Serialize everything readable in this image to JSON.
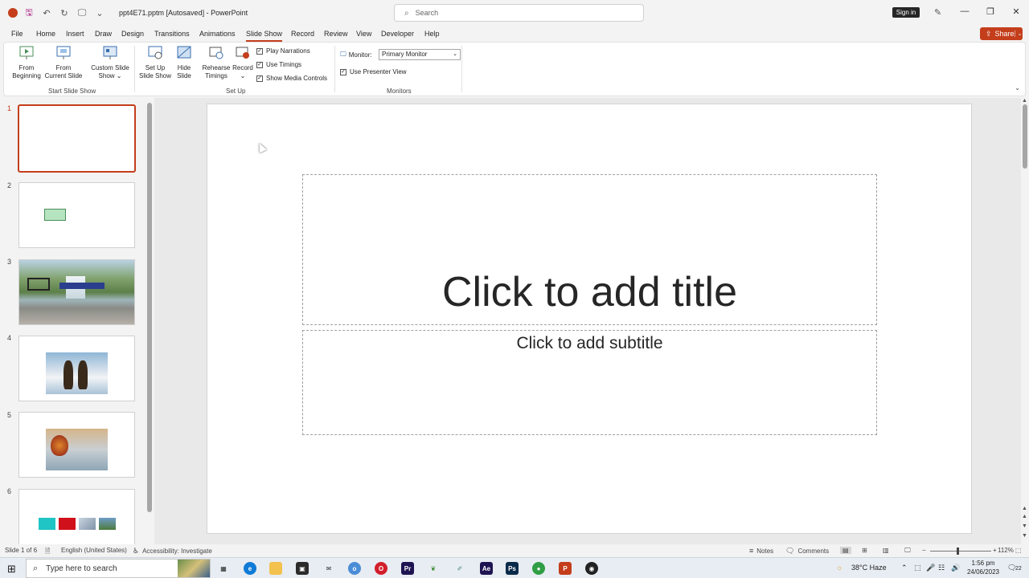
{
  "titlebar": {
    "doc_title": "ppt4E71.pptm [Autosaved]  -  PowerPoint",
    "search_placeholder": "Search",
    "signin_label": "Sign in"
  },
  "ribbon_tabs": [
    "File",
    "Home",
    "Insert",
    "Draw",
    "Design",
    "Transitions",
    "Animations",
    "Slide Show",
    "Record",
    "Review",
    "View",
    "Developer",
    "Help"
  ],
  "active_tab": "Slide Show",
  "share_label": "Share",
  "ribbon": {
    "start_group": {
      "label": "Start Slide Show",
      "from_beginning": [
        "From",
        "Beginning"
      ],
      "from_current": [
        "From",
        "Current Slide"
      ],
      "custom": [
        "Custom Slide",
        "Show ⌄"
      ]
    },
    "setup_group": {
      "label": "Set Up",
      "setup_show": [
        "Set Up",
        "Slide Show"
      ],
      "hide_slide": [
        "Hide",
        "Slide"
      ],
      "rehearse": [
        "Rehearse",
        "Timings"
      ],
      "record": [
        "Record",
        "⌄"
      ],
      "play_narrations": "Play Narrations",
      "use_timings": "Use Timings",
      "show_media_controls": "Show Media Controls"
    },
    "monitors_group": {
      "label": "Monitors",
      "monitor_label": "Monitor:",
      "monitor_value": "Primary Monitor",
      "presenter_view": "Use Presenter View"
    }
  },
  "thumbnails": [
    {
      "num": "1"
    },
    {
      "num": "2"
    },
    {
      "num": "3"
    },
    {
      "num": "4"
    },
    {
      "num": "5"
    },
    {
      "num": "6"
    }
  ],
  "slide": {
    "title_placeholder": "Click to add title",
    "subtitle_placeholder": "Click to add subtitle"
  },
  "statusbar": {
    "slide_info": "Slide 1 of 6",
    "language": "English (United States)",
    "accessibility": "Accessibility: Investigate",
    "notes": "Notes",
    "comments": "Comments",
    "zoom": "112%"
  },
  "taskbar": {
    "search_placeholder": "Type here to search",
    "weather": "38°C  Haze",
    "time": "1:56 pm",
    "date": "24/06/2023",
    "notifications": "22"
  },
  "colors": {
    "accent": "#c43e1c"
  }
}
